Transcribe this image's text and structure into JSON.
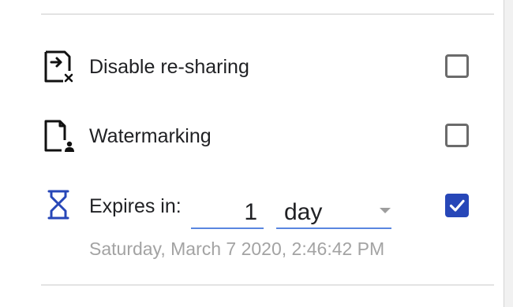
{
  "options": {
    "disable_resharing": {
      "label": "Disable re-sharing",
      "icon": "file-share-blocked-icon",
      "checked": false
    },
    "watermarking": {
      "label": "Watermarking",
      "icon": "file-watermark-user-icon",
      "checked": false
    },
    "expires": {
      "label": "Expires in:",
      "icon": "hourglass-icon",
      "amount": "1",
      "unit": "day",
      "checked": true,
      "expiry_date": "Saturday, March 7 2020, 2:46:42 PM"
    }
  },
  "colors": {
    "accent": "#2747b8",
    "field_underline": "#5a86e0",
    "hint_text": "#a3a3a3",
    "icon_dark": "#111111"
  }
}
